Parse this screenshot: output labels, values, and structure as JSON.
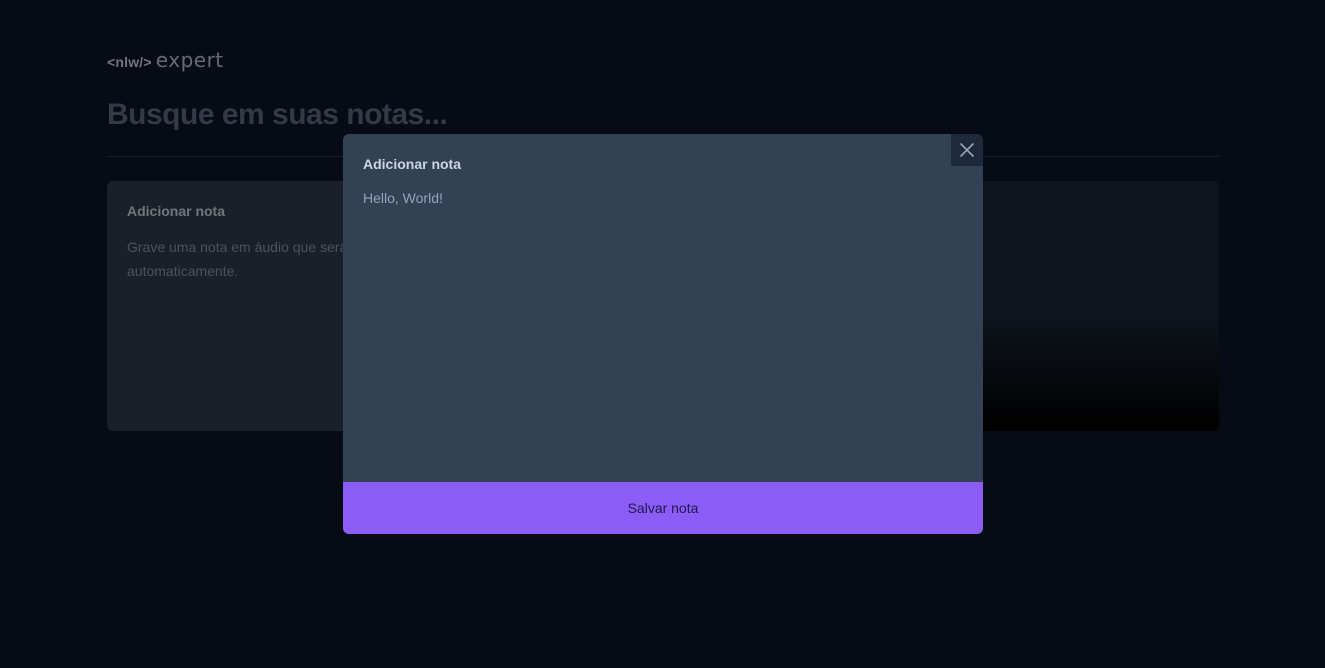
{
  "logo": {
    "tag": "<nlw/>",
    "word": "expert"
  },
  "search": {
    "placeholder": "Busque em suas notas..."
  },
  "card": {
    "title": "Adicionar nota",
    "description": "Grave uma nota em áudio que será convertida para texto automaticamente."
  },
  "modal": {
    "title": "Adicionar nota",
    "content": "Hello, World!",
    "close_icon": "x-icon",
    "save_label": "Salvar nota"
  },
  "colors": {
    "background": "#0f172a",
    "surface": "#334155",
    "accent": "#8b5cf6"
  }
}
